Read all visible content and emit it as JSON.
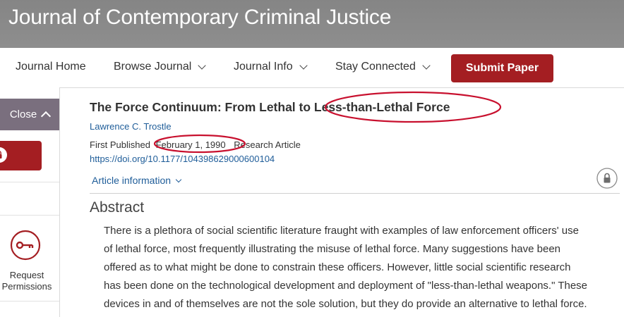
{
  "journal": {
    "title": "Journal of Contemporary Criminal Justice"
  },
  "nav": {
    "items": [
      "Journal Home",
      "Browse Journal",
      "Journal Info",
      "Stay Connected"
    ],
    "submit_label": "Submit Paper",
    "accent_color": "#a41e22"
  },
  "sidebar": {
    "close_label": "Close",
    "permissions_label_line1": "Request",
    "permissions_label_line2": "Permissions",
    "tab_color": "#7a6f7e"
  },
  "article": {
    "title": "The Force Continuum: From Lethal to Less-than-Lethal Force",
    "author": "Lawrence C. Trostle",
    "first_published_label": "First Published",
    "date": "February 1, 1990",
    "type": "Research Article",
    "doi": "https://doi.org/10.1177/104398629000600104",
    "info_label": "Article information",
    "link_color": "#1f5d99"
  },
  "abstract": {
    "heading": "Abstract",
    "lines": [
      "There is a plethora of social scientific literature fraught with examples of law enforcement officers' use",
      "of lethal force, most frequently illustrating the misuse of lethal force. Many suggestions have been",
      "offered as to what might be done to constrain these officers. However, little social scientific research",
      "has been done on the technological development and deployment of \"less-than-lethal weapons.\" These",
      "devices in and of themselves are not the sole solution, but they do provide an alternative to lethal force."
    ]
  },
  "annotations": {
    "color": "#c8102e"
  }
}
